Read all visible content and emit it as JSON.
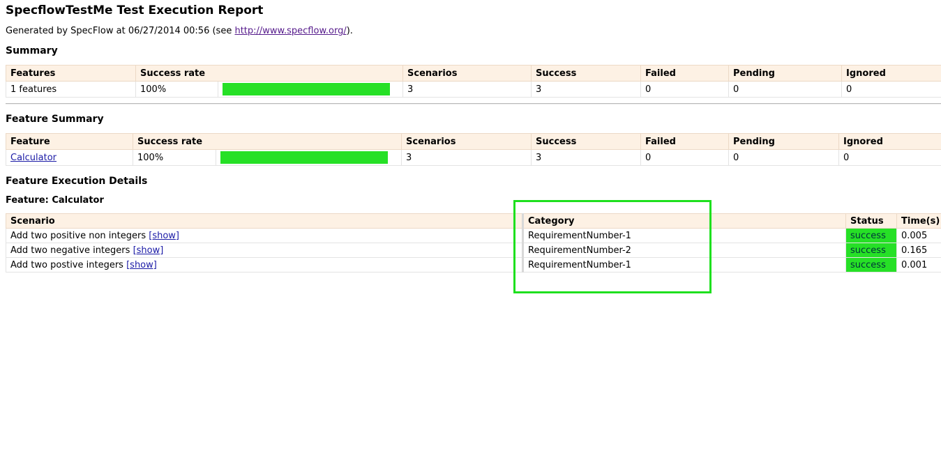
{
  "report": {
    "title": "SpecflowTestMe Test Execution Report",
    "generated_prefix": "Generated by SpecFlow at 06/27/2014 00:56 (see ",
    "generated_link": "http://www.specflow.org/",
    "generated_suffix": ")."
  },
  "summary": {
    "heading": "Summary",
    "headers": [
      "Features",
      "Success rate",
      "Scenarios",
      "Success",
      "Failed",
      "Pending",
      "Ignored"
    ],
    "row": {
      "features": "1 features",
      "success_rate": "100%",
      "success_fraction": 1.0,
      "scenarios": "3",
      "success": "3",
      "failed": "0",
      "pending": "0",
      "ignored": "0"
    }
  },
  "feature_summary": {
    "heading": "Feature Summary",
    "headers": [
      "Feature",
      "Success rate",
      "Scenarios",
      "Success",
      "Failed",
      "Pending",
      "Ignored"
    ],
    "row": {
      "feature": "Calculator",
      "success_rate": "100%",
      "success_fraction": 1.0,
      "scenarios": "3",
      "success": "3",
      "failed": "0",
      "pending": "0",
      "ignored": "0"
    }
  },
  "details": {
    "heading": "Feature Execution Details",
    "feature_title": "Feature: Calculator",
    "headers": [
      "Scenario",
      "Category",
      "Status",
      "Time(s)"
    ],
    "show_label": "[show]",
    "rows": [
      {
        "scenario": "Add two positive non integers",
        "category": "RequirementNumber-1",
        "status": "success",
        "time": "0.005"
      },
      {
        "scenario": "Add two negative integers",
        "category": "RequirementNumber-2",
        "status": "success",
        "time": "0.165"
      },
      {
        "scenario": "Add two postive integers",
        "category": "RequirementNumber-1",
        "status": "success",
        "time": "0.001"
      }
    ]
  },
  "colors": {
    "success_green": "#26e026",
    "header_bg": "#fdf1e4",
    "highlight_box": "#1ee01e",
    "link": "#1a1aa6"
  }
}
